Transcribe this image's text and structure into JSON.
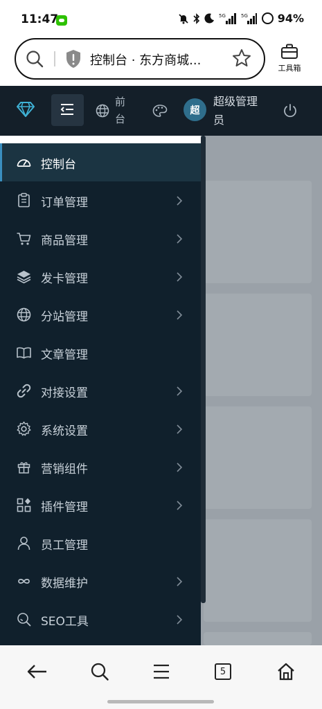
{
  "status_bar": {
    "time": "11:47",
    "network_label": "5G",
    "battery": "94%"
  },
  "address_bar": {
    "title": "控制台 · 东方商城...",
    "toolbox_label": "工具箱"
  },
  "admin_header": {
    "front_label": "前台",
    "avatar_initial": "超",
    "user_name": "超级管理员"
  },
  "sidebar": {
    "items": [
      {
        "label": "控制台",
        "icon": "dashboard-icon",
        "active": true,
        "has_children": false
      },
      {
        "label": "订单管理",
        "icon": "clipboard-icon",
        "active": false,
        "has_children": true
      },
      {
        "label": "商品管理",
        "icon": "cart-icon",
        "active": false,
        "has_children": true
      },
      {
        "label": "发卡管理",
        "icon": "layers-icon",
        "active": false,
        "has_children": true
      },
      {
        "label": "分站管理",
        "icon": "globe-icon",
        "active": false,
        "has_children": true
      },
      {
        "label": "文章管理",
        "icon": "book-icon",
        "active": false,
        "has_children": false
      },
      {
        "label": "对接设置",
        "icon": "link-icon",
        "active": false,
        "has_children": true
      },
      {
        "label": "系统设置",
        "icon": "gear-icon",
        "active": false,
        "has_children": true
      },
      {
        "label": "营销组件",
        "icon": "gift-icon",
        "active": false,
        "has_children": true
      },
      {
        "label": "插件管理",
        "icon": "apps-icon",
        "active": false,
        "has_children": true
      },
      {
        "label": "员工管理",
        "icon": "user-icon",
        "active": false,
        "has_children": false
      },
      {
        "label": "数据维护",
        "icon": "infinity-icon",
        "active": false,
        "has_children": true
      },
      {
        "label": "SEO工具",
        "icon": "seo-search-icon",
        "active": false,
        "has_children": true
      }
    ]
  },
  "bottom_nav": {
    "tab_count": "5"
  },
  "colors": {
    "sidebar_bg": "#10202c",
    "header_bg": "#141f29",
    "active_bg": "#1b3442",
    "accent": "#3a8fc0",
    "logo": "#3fb2d6"
  }
}
